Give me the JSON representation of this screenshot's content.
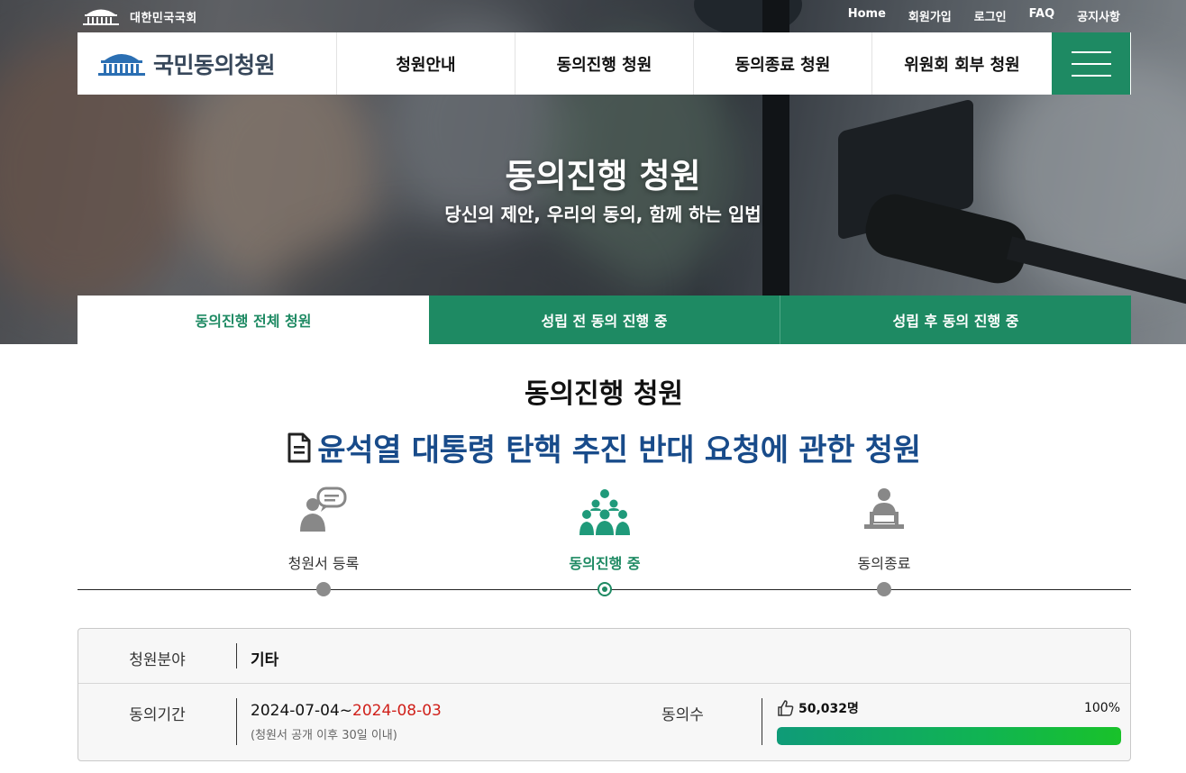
{
  "top": {
    "assembly_name": "대한민국국회",
    "links": [
      "Home",
      "회원가입",
      "로그인",
      "FAQ",
      "공지사항"
    ]
  },
  "nav": {
    "brand": "국민동의청원",
    "items": [
      "청원안내",
      "동의진행 청원",
      "동의종료 청원",
      "위원회 회부 청원"
    ]
  },
  "hero": {
    "title": "동의진행 청원",
    "subtitle": "당신의 제안, 우리의 동의, 함께 하는 입법"
  },
  "tabs": [
    "동의진행 전체 청원",
    "성립 전 동의 진행 중",
    "성립 후 동의 진행 중"
  ],
  "section_title": "동의진행 청원",
  "petition_title": "윤석열 대통령 탄핵 추진 반대 요청에 관한 청원",
  "steps": [
    {
      "label": "청원서 등록",
      "icon": "petition-register-icon",
      "active": false
    },
    {
      "label": "동의진행 중",
      "icon": "agreement-progress-icon",
      "active": true
    },
    {
      "label": "동의종료",
      "icon": "agreement-closed-icon",
      "active": false
    }
  ],
  "info": {
    "field_label": "청원분야",
    "field_value": "기타",
    "period_label": "동의기간",
    "period_start": "2024-07-04~",
    "period_end": "2024-08-03",
    "period_note": "(청원서 공개 이후 30일 이내)",
    "count_label": "동의수",
    "count_value": "50,032명",
    "percent_text": "100%",
    "progress": 1.0
  },
  "colors": {
    "primary_green": "#1e8a63",
    "title_blue": "#184b8a",
    "end_date_red": "#d0201a"
  }
}
